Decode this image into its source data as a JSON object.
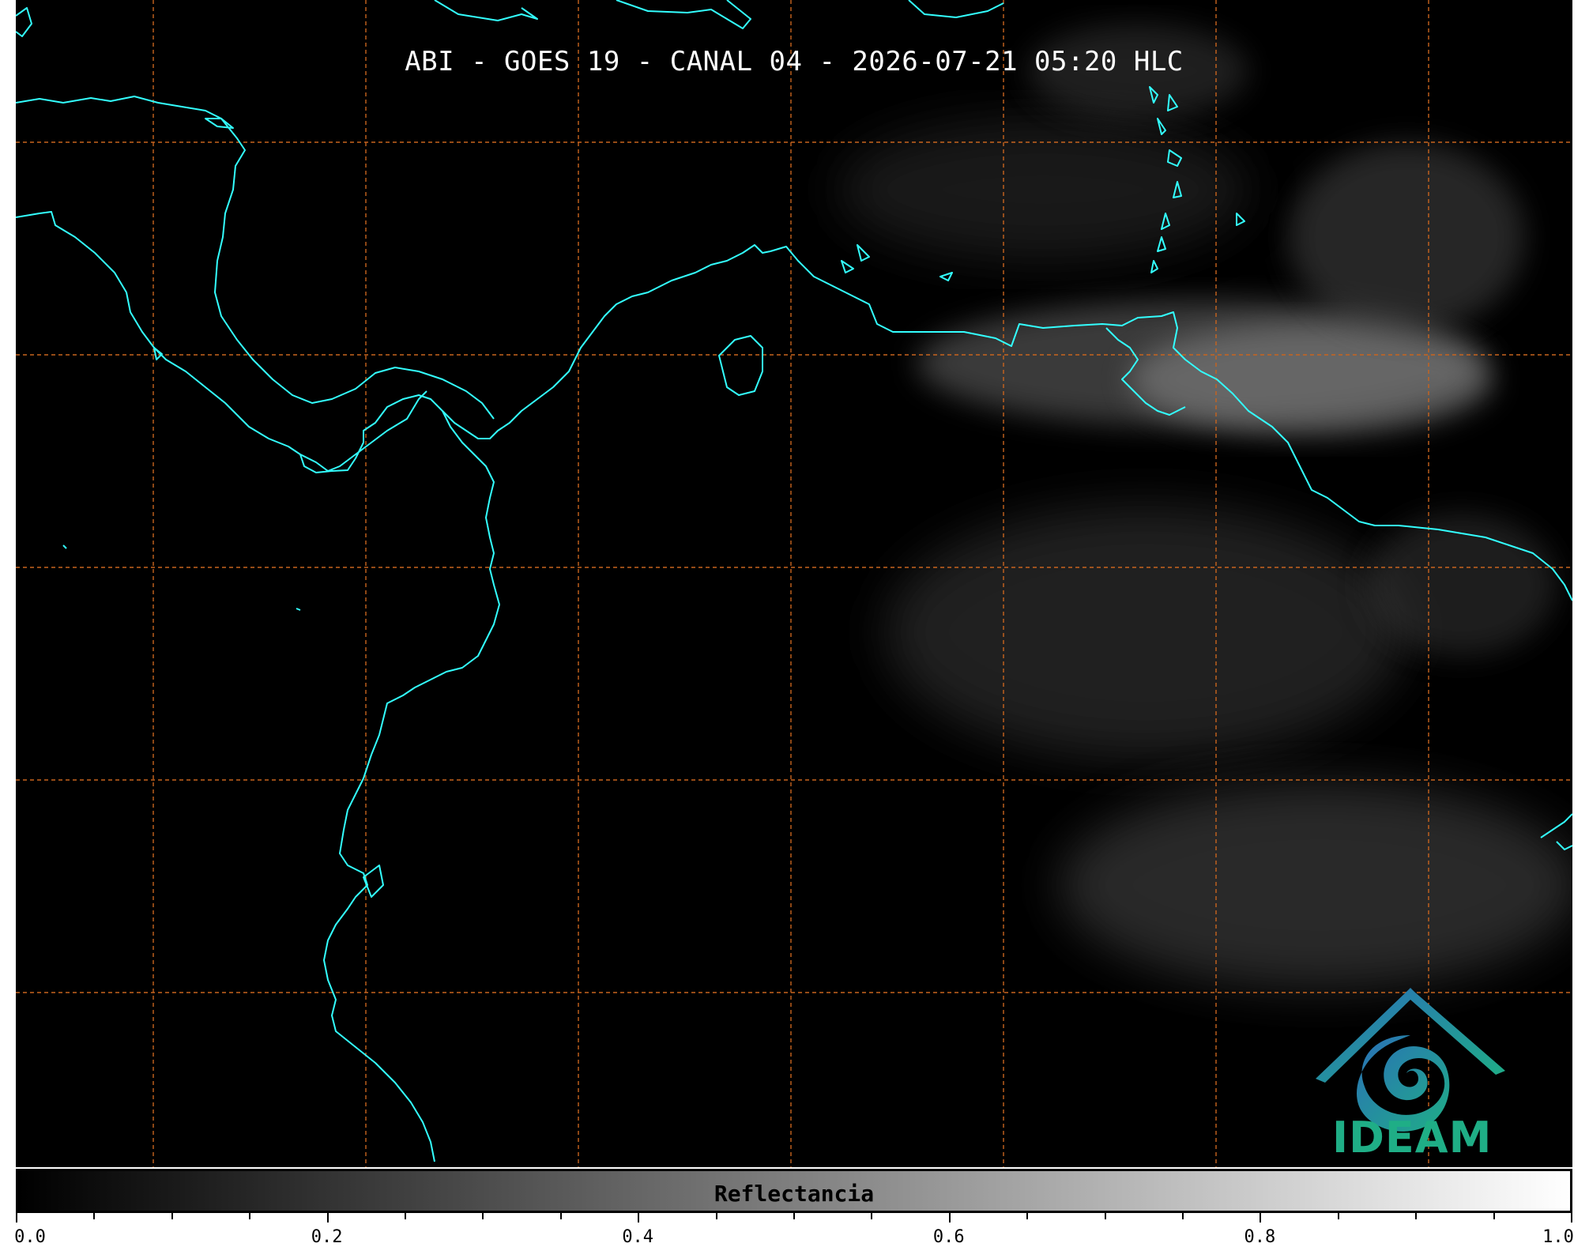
{
  "title": "ABI - GOES 19 - CANAL 04 - 2026-07-21 05:20 HLC",
  "colorbar": {
    "label": "Reflectancia",
    "range": [
      0.0,
      1.0
    ],
    "tick_labels": [
      "0.0",
      "0.2",
      "0.4",
      "0.6",
      "0.8",
      "1.0"
    ],
    "major_ticks": [
      0.0,
      0.2,
      0.4,
      0.6,
      0.8,
      1.0
    ],
    "minor_step": 0.05
  },
  "logo": {
    "text": "IDEAM"
  },
  "colors": {
    "background": "#000000",
    "coastline": "#33ffff",
    "gridlines": "#c8641e",
    "logo_teal": "#1fae86",
    "logo_blue": "#2a6fb8"
  },
  "icons": [
    "ideam-logo-icon"
  ]
}
